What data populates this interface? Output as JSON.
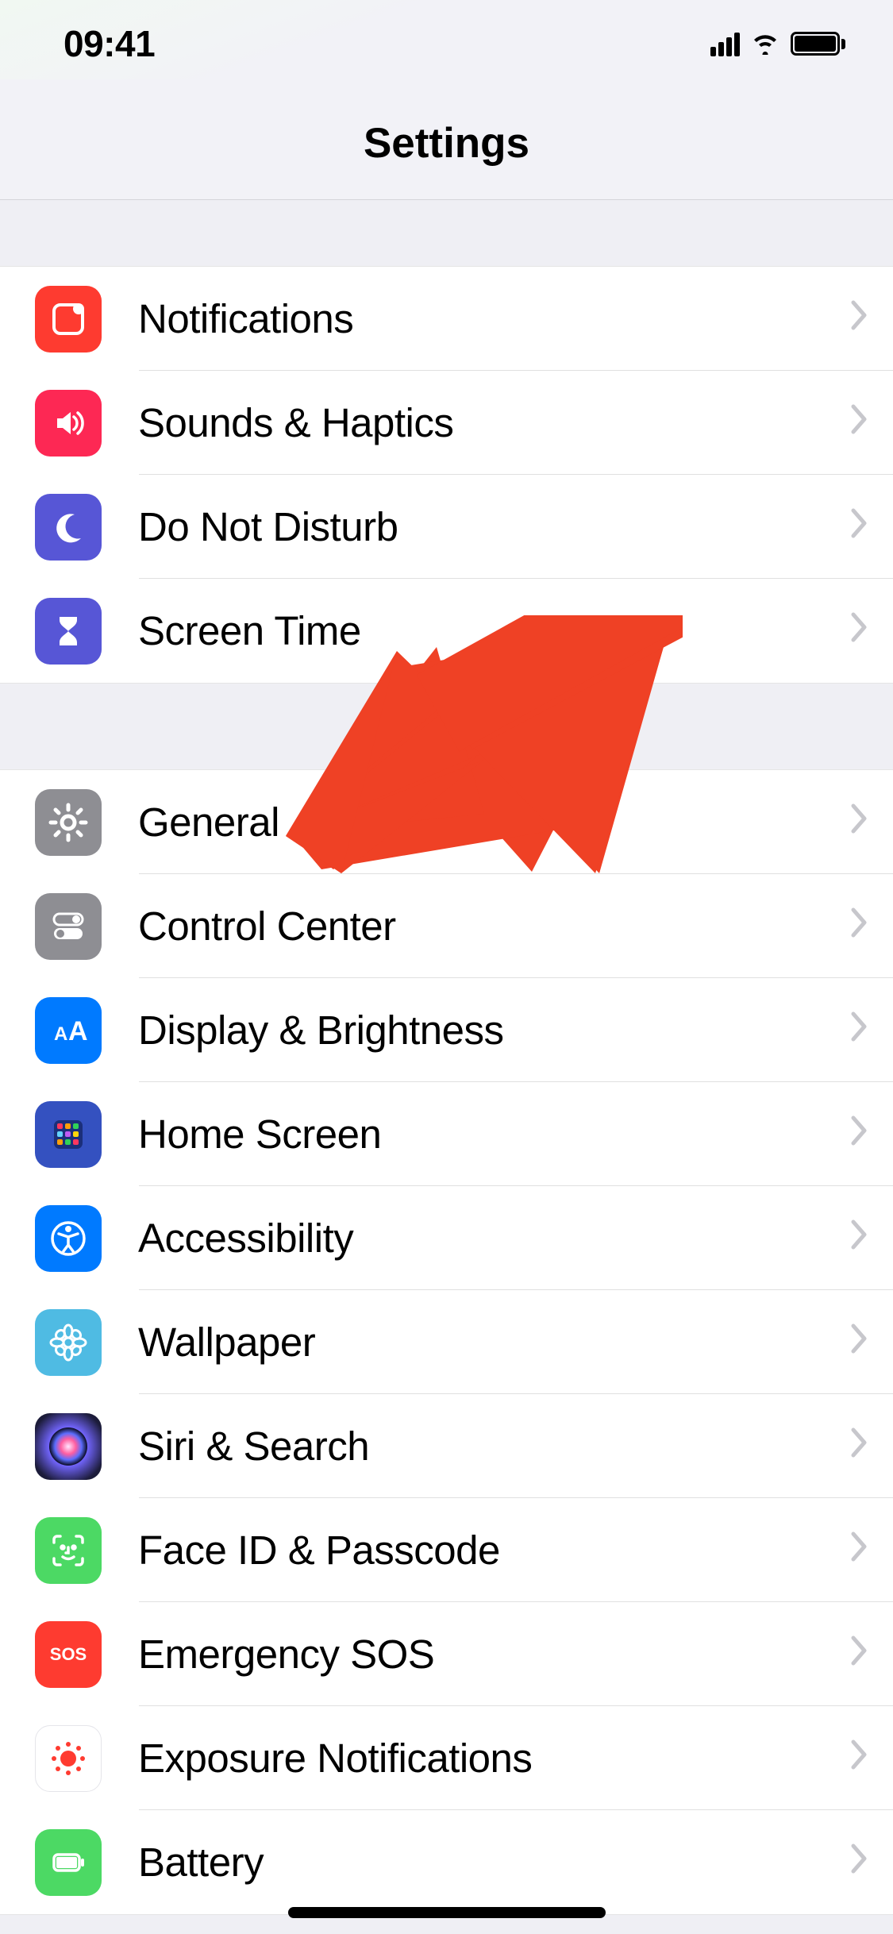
{
  "status": {
    "time": "09:41"
  },
  "header": {
    "title": "Settings"
  },
  "section1": [
    {
      "id": "notifications",
      "label": "Notifications",
      "bg": "#fe3b30"
    },
    {
      "id": "sounds",
      "label": "Sounds & Haptics",
      "bg": "#fd2854"
    },
    {
      "id": "dnd",
      "label": "Do Not Disturb",
      "bg": "#5756d6"
    },
    {
      "id": "screentime",
      "label": "Screen Time",
      "bg": "#5756d6"
    }
  ],
  "section2": [
    {
      "id": "general",
      "label": "General",
      "bg": "#8e8e93"
    },
    {
      "id": "controlcenter",
      "label": "Control Center",
      "bg": "#8e8e93"
    },
    {
      "id": "display",
      "label": "Display & Brightness",
      "bg": "#007aff"
    },
    {
      "id": "homescreen",
      "label": "Home Screen",
      "bg": "#3451c0"
    },
    {
      "id": "accessibility",
      "label": "Accessibility",
      "bg": "#007aff"
    },
    {
      "id": "wallpaper",
      "label": "Wallpaper",
      "bg": "#4fbbe3"
    },
    {
      "id": "siri",
      "label": "Siri & Search",
      "bg": "#1c1c1e"
    },
    {
      "id": "faceid",
      "label": "Face ID & Passcode",
      "bg": "#4cd964"
    },
    {
      "id": "sos",
      "label": "Emergency SOS",
      "bg": "#fe3b30"
    },
    {
      "id": "exposure",
      "label": "Exposure Notifications",
      "bg": "#ffffff"
    },
    {
      "id": "battery",
      "label": "Battery",
      "bg": "#4cd964"
    }
  ],
  "annotation": {
    "target": "general",
    "color": "#ef4125"
  }
}
